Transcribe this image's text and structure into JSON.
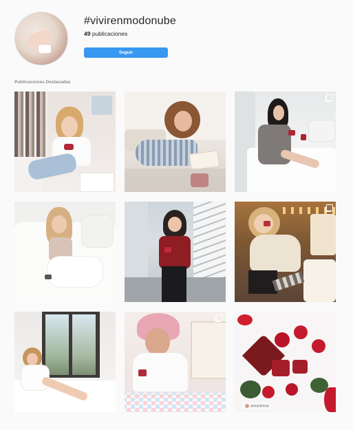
{
  "profile": {
    "hashtag": "#vivirenmodonube",
    "post_count": "49",
    "post_count_label": "publicaciones",
    "follow_label": "Seguir"
  },
  "featured": {
    "title": "Publicaciones Destacadas",
    "tiles": [
      {
        "name": "post-closet-selfie",
        "multi": false
      },
      {
        "name": "post-sofa-book",
        "multi": false
      },
      {
        "name": "post-bed-blazer",
        "multi": true
      },
      {
        "name": "post-white-sofa",
        "multi": false
      },
      {
        "name": "post-stairs-red",
        "multi": false
      },
      {
        "name": "post-sweater-cozy",
        "multi": true
      },
      {
        "name": "post-window-bath",
        "multi": false
      },
      {
        "name": "post-towel-mask",
        "multi": true
      },
      {
        "name": "post-roses-flatlay",
        "multi": false
      }
    ],
    "watermark_user": "annasimosa"
  },
  "colors": {
    "follow_button": "#3897f0",
    "background": "#fafafa"
  }
}
